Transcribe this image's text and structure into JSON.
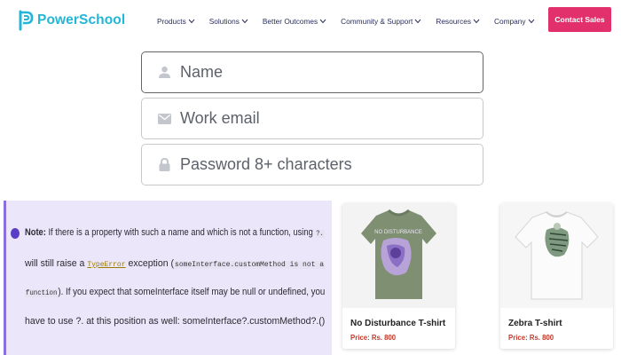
{
  "brand": {
    "name": "PowerSchool",
    "color": "#24b6d6"
  },
  "nav": {
    "items": [
      {
        "label": "Products"
      },
      {
        "label": "Solutions"
      },
      {
        "label": "Better Outcomes"
      },
      {
        "label": "Community & Support"
      },
      {
        "label": "Resources"
      },
      {
        "label": "Company"
      }
    ],
    "contact_label": "Contact Sales",
    "contact_color": "#e2306c"
  },
  "form": {
    "name_placeholder": "Name",
    "email_placeholder": "Work email",
    "password_placeholder": "Password 8+ characters"
  },
  "note": {
    "lead": "Note:",
    "line1": " If there is a property with such a name and which is not a function, using ",
    "line1_code": "?.",
    "line2_a": "will still raise a ",
    "line2_type": "TypeError",
    "line2_b": " exception (",
    "line2_code": "someInterface.customMethod is not a",
    "line3_code": "function",
    "line3_b": "). If you expect that someInterface itself may be null or undefined, you",
    "line4": "have to use ?. at this position as well: someInterface?.customMethod?.()"
  },
  "products": [
    {
      "name": "No Disturbance T-shirt",
      "price": "Price: Rs. 800",
      "shirt_color": "#7f8f72",
      "art": "anime-print"
    },
    {
      "name": "Zebra T-shirt",
      "price": "Price: Rs. 800",
      "shirt_color": "#f4f4f4",
      "art": "zebra-print"
    }
  ]
}
